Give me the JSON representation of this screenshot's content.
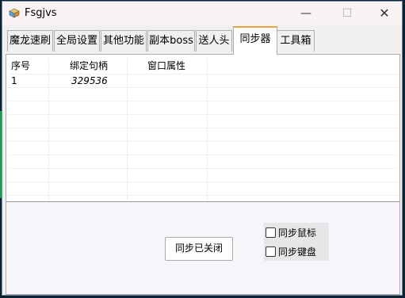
{
  "window": {
    "title": "Fsgjvs",
    "minimize_glyph": "—",
    "maximize_glyph": "☐",
    "close_glyph": "✕"
  },
  "tabs": [
    {
      "label": "魔龙速刷",
      "active": false
    },
    {
      "label": "全局设置",
      "active": false
    },
    {
      "label": "其他功能",
      "active": false
    },
    {
      "label": "副本boss",
      "active": false
    },
    {
      "label": "送人头",
      "active": false
    },
    {
      "label": "同步器",
      "active": true
    },
    {
      "label": "工具箱",
      "active": false
    }
  ],
  "table": {
    "columns": [
      "序号",
      "绑定句柄",
      "窗口属性"
    ],
    "rows": [
      {
        "index": "1",
        "handle": "329536",
        "attr": ""
      }
    ]
  },
  "sync": {
    "toggle_label": "同步已关闭",
    "mouse_label": "同步鼠标",
    "mouse_checked": false,
    "keyboard_label": "同步键盘",
    "keyboard_checked": false
  },
  "colors": {
    "active_tab_accent": "#e7a53a",
    "background": "#0c2230"
  }
}
